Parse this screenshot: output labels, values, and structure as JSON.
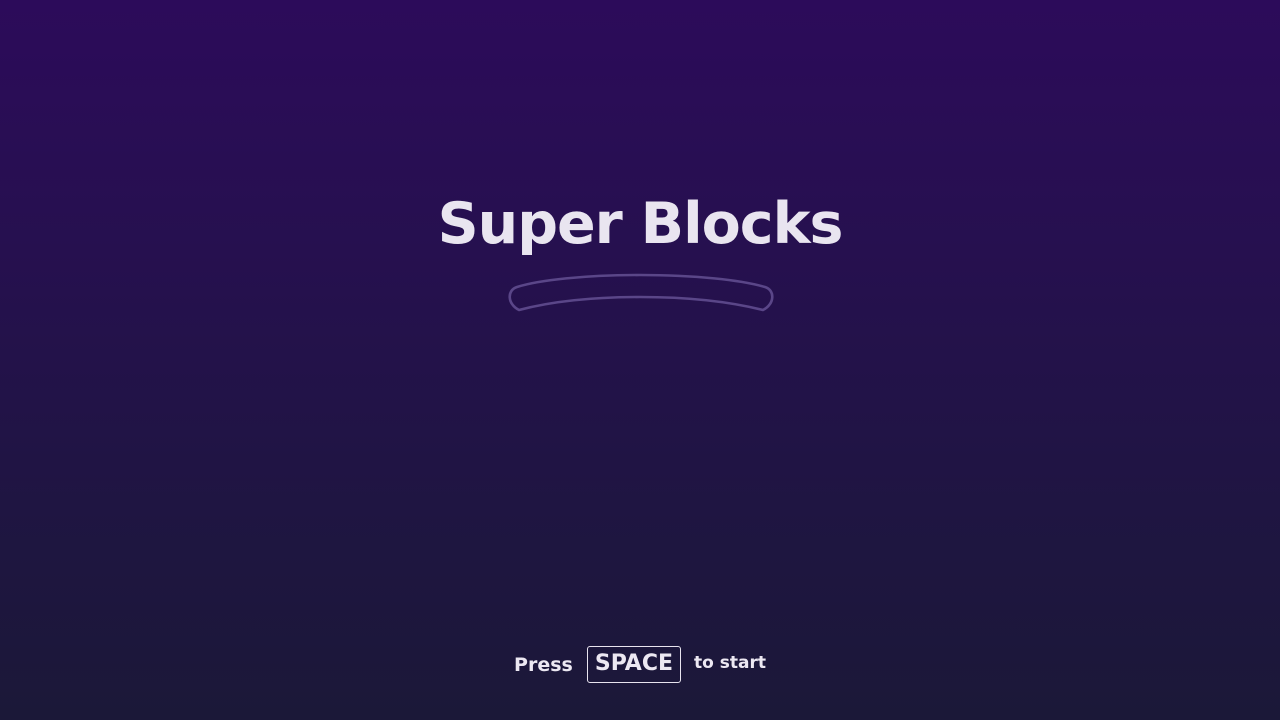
{
  "title": "Super Blocks",
  "prompt": {
    "prefix": "Press",
    "key": "SPACE",
    "suffix": "to start"
  },
  "colors": {
    "background_top": "#2c0b5a",
    "background_bottom": "#1b1838",
    "text": "#e9e5f0",
    "swoosh_stroke": "#5a4688"
  },
  "icons": {
    "decoration": "swoosh-underline-icon"
  }
}
